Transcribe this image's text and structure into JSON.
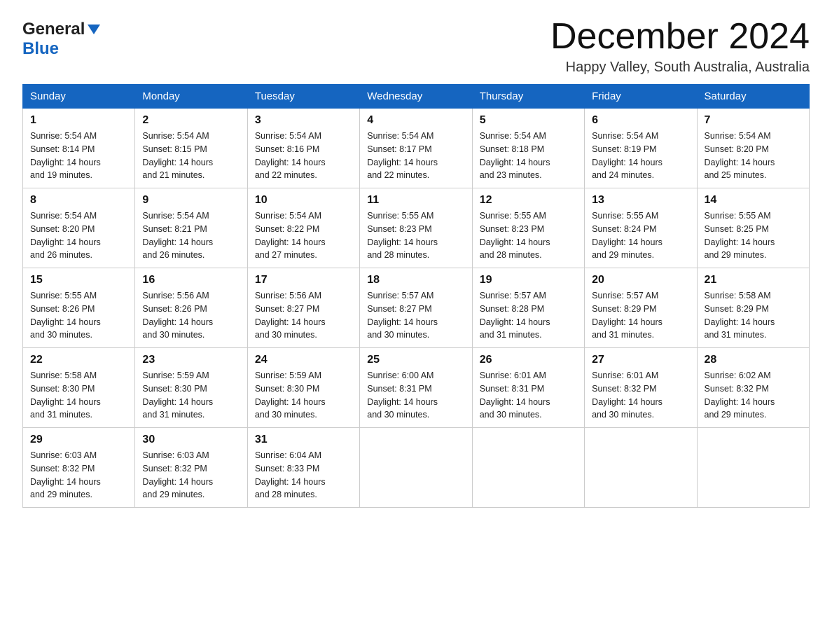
{
  "logo": {
    "general": "General",
    "blue": "Blue"
  },
  "title": "December 2024",
  "location": "Happy Valley, South Australia, Australia",
  "weekdays": [
    "Sunday",
    "Monday",
    "Tuesday",
    "Wednesday",
    "Thursday",
    "Friday",
    "Saturday"
  ],
  "weeks": [
    [
      {
        "day": "1",
        "sunrise": "5:54 AM",
        "sunset": "8:14 PM",
        "daylight": "14 hours and 19 minutes."
      },
      {
        "day": "2",
        "sunrise": "5:54 AM",
        "sunset": "8:15 PM",
        "daylight": "14 hours and 21 minutes."
      },
      {
        "day": "3",
        "sunrise": "5:54 AM",
        "sunset": "8:16 PM",
        "daylight": "14 hours and 22 minutes."
      },
      {
        "day": "4",
        "sunrise": "5:54 AM",
        "sunset": "8:17 PM",
        "daylight": "14 hours and 22 minutes."
      },
      {
        "day": "5",
        "sunrise": "5:54 AM",
        "sunset": "8:18 PM",
        "daylight": "14 hours and 23 minutes."
      },
      {
        "day": "6",
        "sunrise": "5:54 AM",
        "sunset": "8:19 PM",
        "daylight": "14 hours and 24 minutes."
      },
      {
        "day": "7",
        "sunrise": "5:54 AM",
        "sunset": "8:20 PM",
        "daylight": "14 hours and 25 minutes."
      }
    ],
    [
      {
        "day": "8",
        "sunrise": "5:54 AM",
        "sunset": "8:20 PM",
        "daylight": "14 hours and 26 minutes."
      },
      {
        "day": "9",
        "sunrise": "5:54 AM",
        "sunset": "8:21 PM",
        "daylight": "14 hours and 26 minutes."
      },
      {
        "day": "10",
        "sunrise": "5:54 AM",
        "sunset": "8:22 PM",
        "daylight": "14 hours and 27 minutes."
      },
      {
        "day": "11",
        "sunrise": "5:55 AM",
        "sunset": "8:23 PM",
        "daylight": "14 hours and 28 minutes."
      },
      {
        "day": "12",
        "sunrise": "5:55 AM",
        "sunset": "8:23 PM",
        "daylight": "14 hours and 28 minutes."
      },
      {
        "day": "13",
        "sunrise": "5:55 AM",
        "sunset": "8:24 PM",
        "daylight": "14 hours and 29 minutes."
      },
      {
        "day": "14",
        "sunrise": "5:55 AM",
        "sunset": "8:25 PM",
        "daylight": "14 hours and 29 minutes."
      }
    ],
    [
      {
        "day": "15",
        "sunrise": "5:55 AM",
        "sunset": "8:26 PM",
        "daylight": "14 hours and 30 minutes."
      },
      {
        "day": "16",
        "sunrise": "5:56 AM",
        "sunset": "8:26 PM",
        "daylight": "14 hours and 30 minutes."
      },
      {
        "day": "17",
        "sunrise": "5:56 AM",
        "sunset": "8:27 PM",
        "daylight": "14 hours and 30 minutes."
      },
      {
        "day": "18",
        "sunrise": "5:57 AM",
        "sunset": "8:27 PM",
        "daylight": "14 hours and 30 minutes."
      },
      {
        "day": "19",
        "sunrise": "5:57 AM",
        "sunset": "8:28 PM",
        "daylight": "14 hours and 31 minutes."
      },
      {
        "day": "20",
        "sunrise": "5:57 AM",
        "sunset": "8:29 PM",
        "daylight": "14 hours and 31 minutes."
      },
      {
        "day": "21",
        "sunrise": "5:58 AM",
        "sunset": "8:29 PM",
        "daylight": "14 hours and 31 minutes."
      }
    ],
    [
      {
        "day": "22",
        "sunrise": "5:58 AM",
        "sunset": "8:30 PM",
        "daylight": "14 hours and 31 minutes."
      },
      {
        "day": "23",
        "sunrise": "5:59 AM",
        "sunset": "8:30 PM",
        "daylight": "14 hours and 31 minutes."
      },
      {
        "day": "24",
        "sunrise": "5:59 AM",
        "sunset": "8:30 PM",
        "daylight": "14 hours and 30 minutes."
      },
      {
        "day": "25",
        "sunrise": "6:00 AM",
        "sunset": "8:31 PM",
        "daylight": "14 hours and 30 minutes."
      },
      {
        "day": "26",
        "sunrise": "6:01 AM",
        "sunset": "8:31 PM",
        "daylight": "14 hours and 30 minutes."
      },
      {
        "day": "27",
        "sunrise": "6:01 AM",
        "sunset": "8:32 PM",
        "daylight": "14 hours and 30 minutes."
      },
      {
        "day": "28",
        "sunrise": "6:02 AM",
        "sunset": "8:32 PM",
        "daylight": "14 hours and 29 minutes."
      }
    ],
    [
      {
        "day": "29",
        "sunrise": "6:03 AM",
        "sunset": "8:32 PM",
        "daylight": "14 hours and 29 minutes."
      },
      {
        "day": "30",
        "sunrise": "6:03 AM",
        "sunset": "8:32 PM",
        "daylight": "14 hours and 29 minutes."
      },
      {
        "day": "31",
        "sunrise": "6:04 AM",
        "sunset": "8:33 PM",
        "daylight": "14 hours and 28 minutes."
      },
      null,
      null,
      null,
      null
    ]
  ],
  "labels": {
    "sunrise": "Sunrise:",
    "sunset": "Sunset:",
    "daylight": "Daylight:"
  }
}
